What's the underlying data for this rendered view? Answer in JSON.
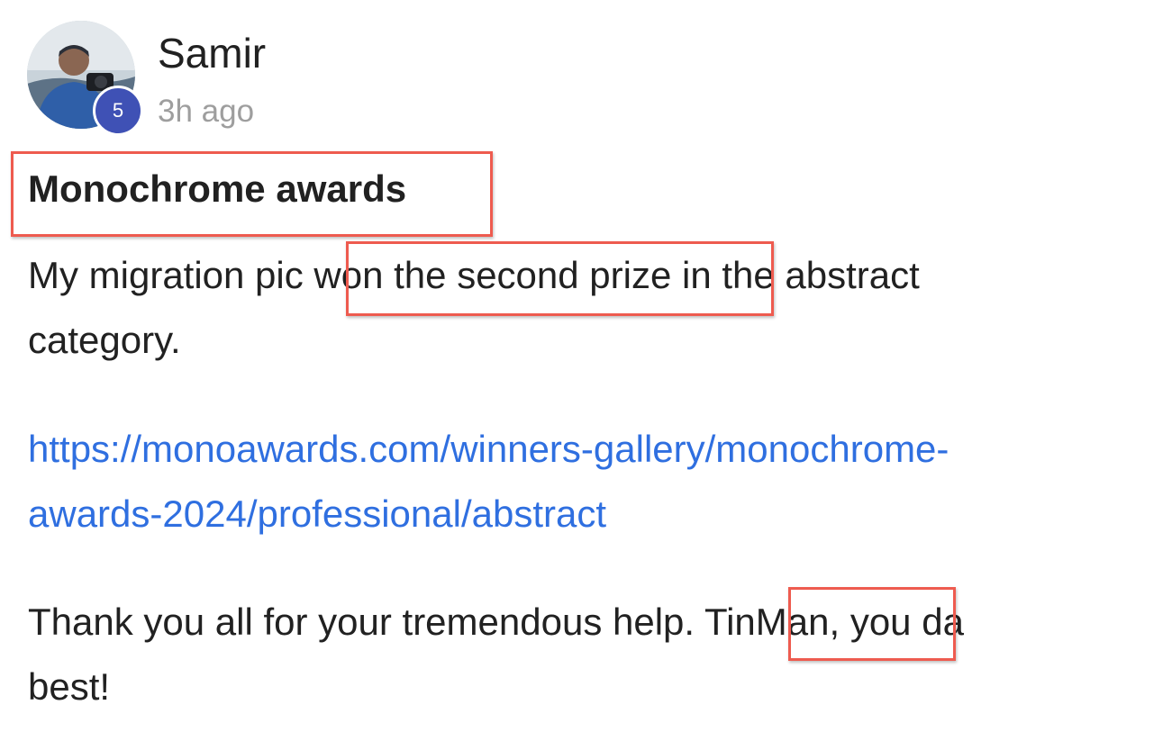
{
  "post": {
    "author": "Samir",
    "timestamp": "3h ago",
    "level_badge": "5",
    "title": "Monochrome awards",
    "para1": {
      "line1_a": "My migration pic ",
      "line1_b": "won the second prize",
      "line1_c": " in the abstract",
      "line2": "category."
    },
    "link": {
      "line1": "https://monoawards.com/winners-gallery/monochrome-",
      "line2": "awards-2024/professional/abstract"
    },
    "para3": {
      "line1_a": "Thank you all for your tremendous help. ",
      "line1_b": "TinMan,",
      "line1_c": " you da",
      "line2": "best!"
    }
  },
  "colors": {
    "highlight_border": "#ee5b4f",
    "link": "#2f6fe0",
    "badge": "#3f51b5",
    "timestamp": "#9e9e9e"
  }
}
